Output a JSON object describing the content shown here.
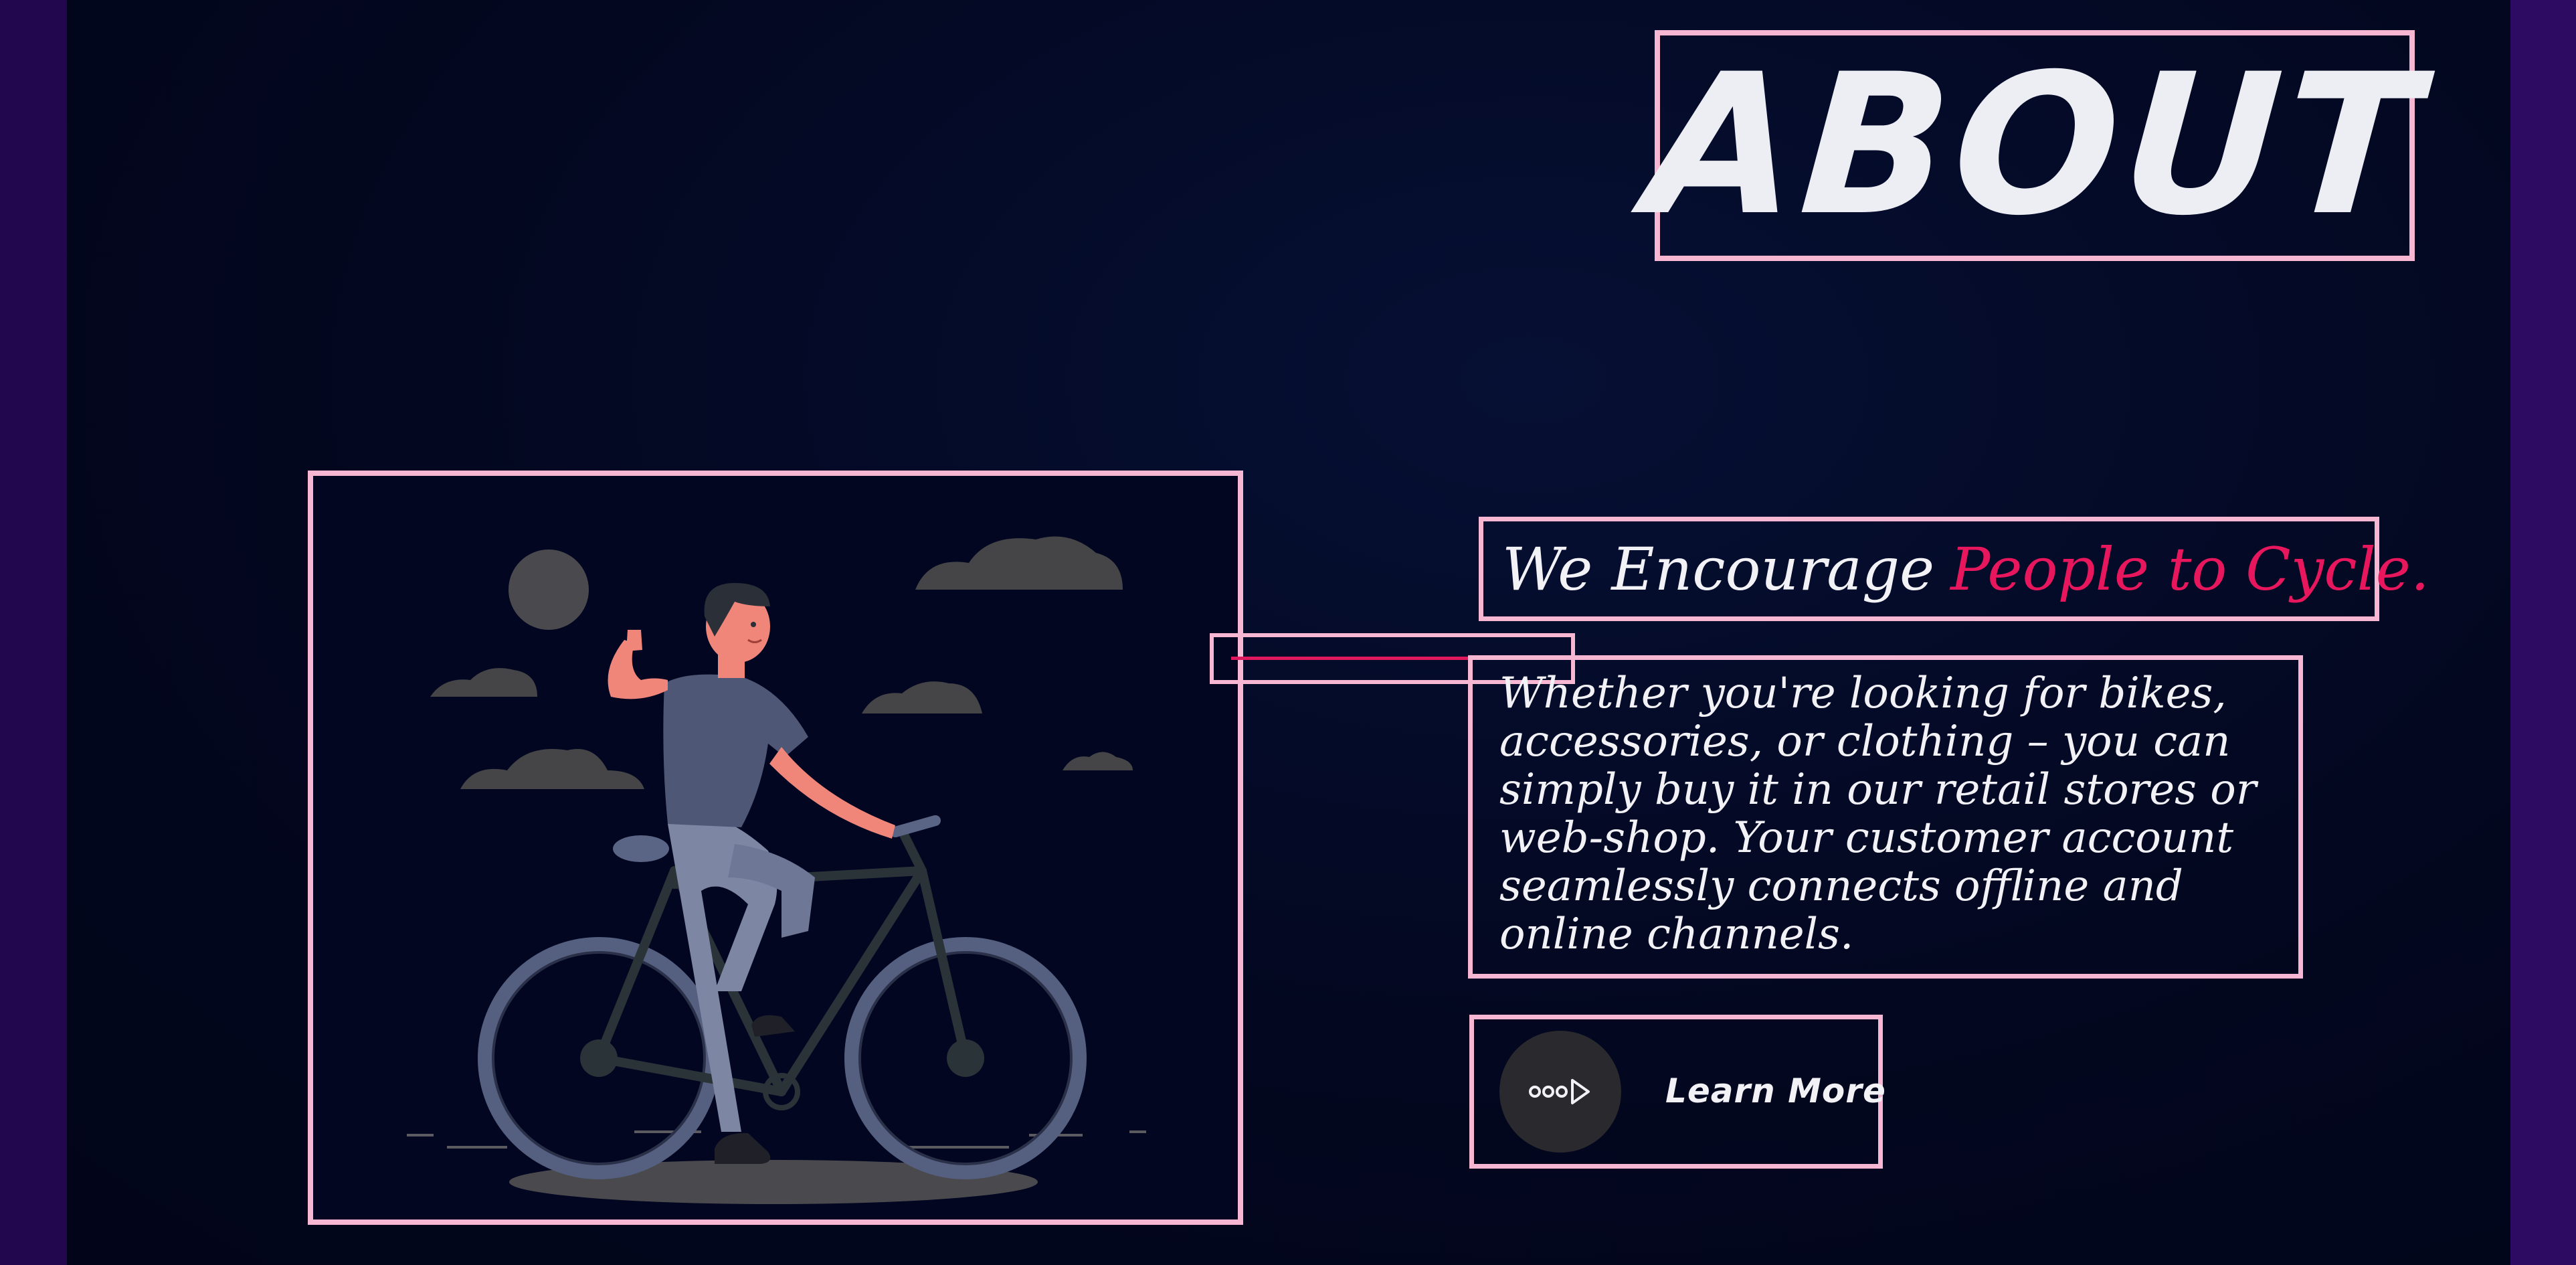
{
  "section": {
    "title": "ABOUT"
  },
  "about": {
    "heading_main": "We Encourage",
    "heading_accent": "People to Cycle.",
    "body": "Whether you're looking for bikes, accessories, or clothing – you can simply buy it in our retail stores or web-shop. Your customer account seamlessly connects offline and online channels.",
    "button_label": "Learn More"
  },
  "colors": {
    "background": "#03071f",
    "frame": "#f7b6d2",
    "accent": "#e8175d",
    "text": "#f2f2f6"
  },
  "icons": {
    "button_icon": "arrow-dots-icon",
    "illustration": "cyclist-illustration"
  }
}
